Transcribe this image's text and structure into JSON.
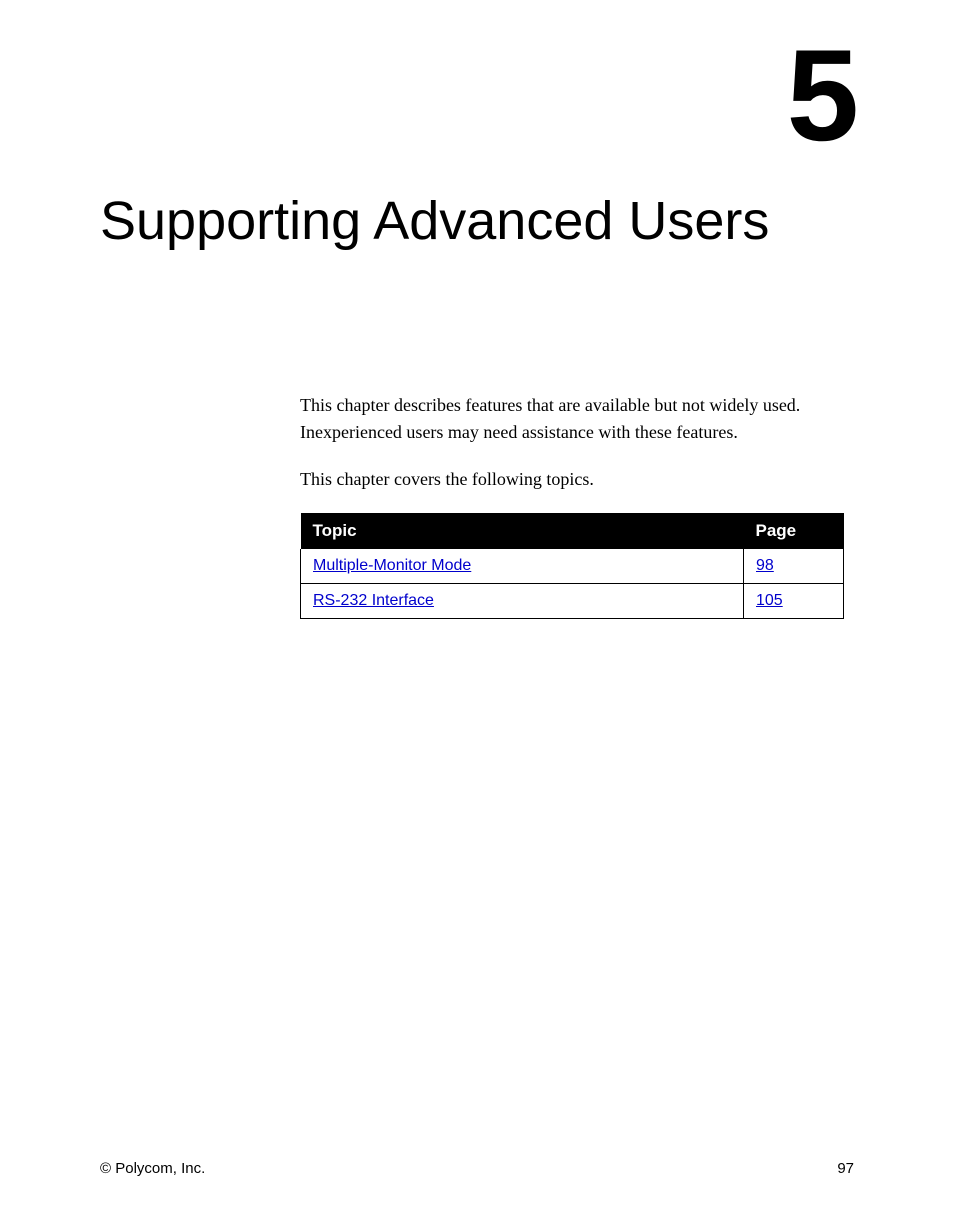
{
  "chapter": {
    "number": "5",
    "title": "Supporting Advanced Users"
  },
  "paragraphs": {
    "p1": "This chapter describes features that are available but not widely used. Inexperienced users may need assistance with these features.",
    "p2": "This chapter covers the following topics."
  },
  "table": {
    "headers": {
      "topic": "Topic",
      "page": "Page"
    },
    "rows": [
      {
        "topic": "Multiple-Monitor Mode",
        "page": "98"
      },
      {
        "topic": "RS-232 Interface",
        "page": "105"
      }
    ]
  },
  "footer": {
    "copyright": "© Polycom, Inc.",
    "page_number": "97"
  }
}
